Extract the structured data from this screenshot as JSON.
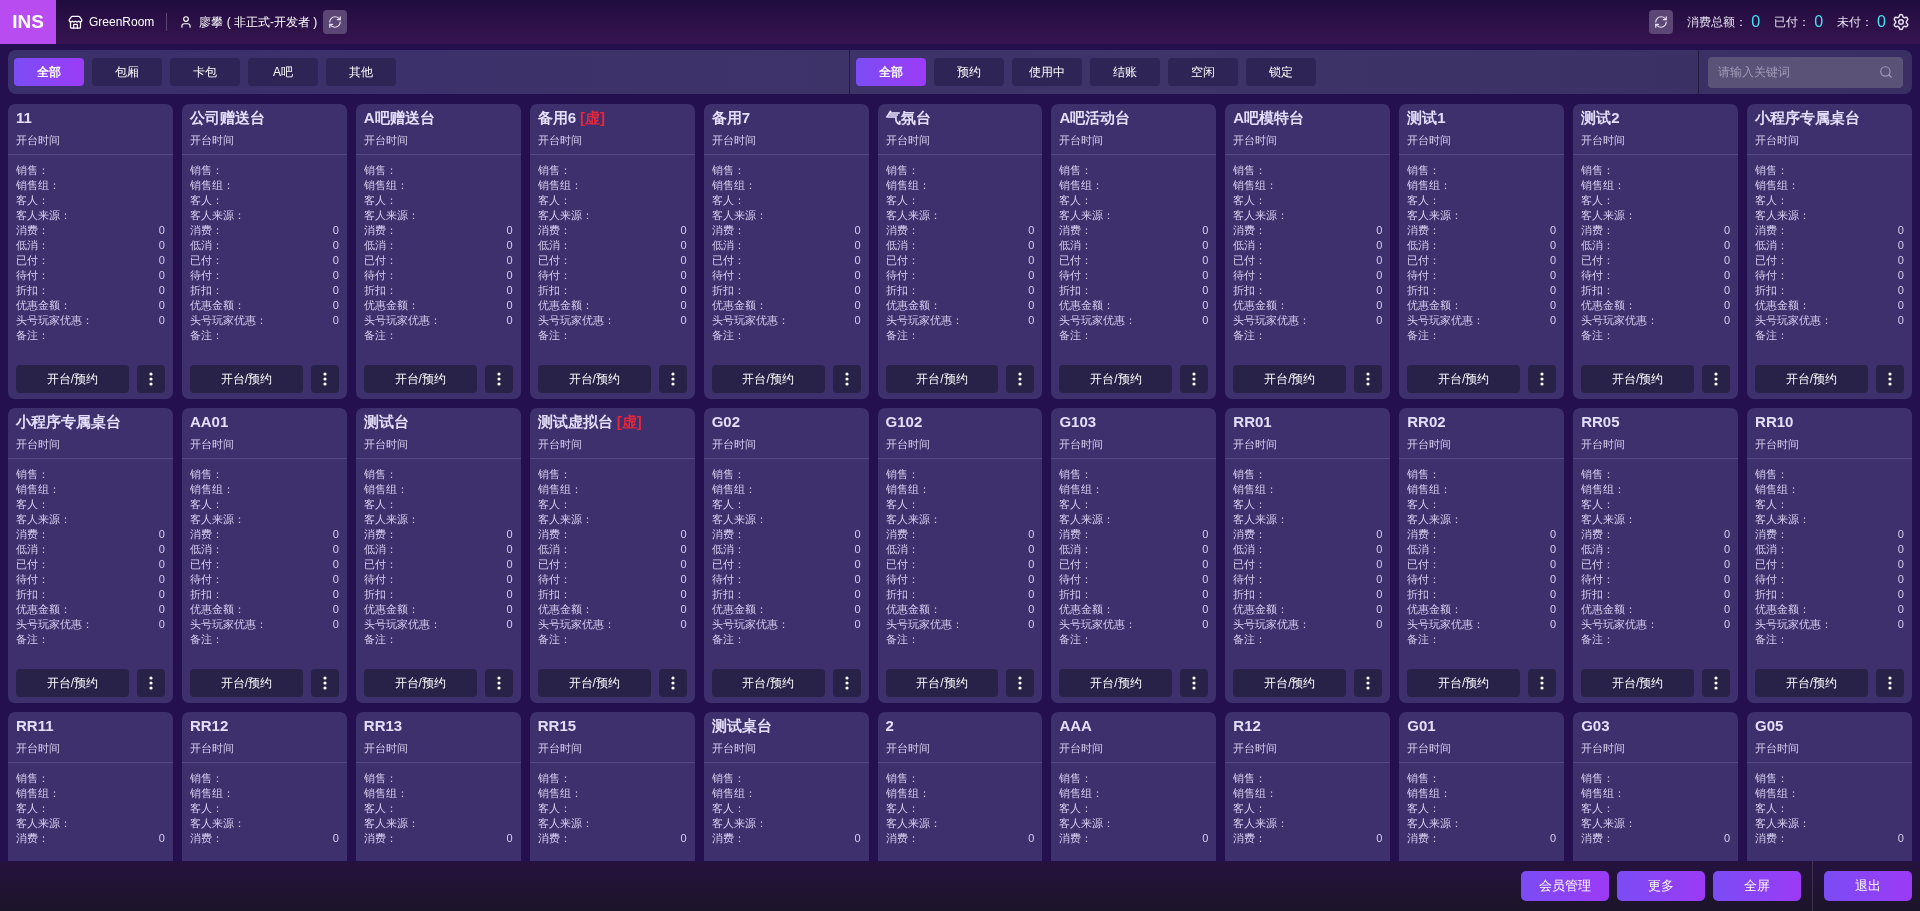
{
  "header": {
    "logo": "INS",
    "store": "GreenRoom",
    "user": "廖攀 ( 非正式-开发者 )",
    "totals": [
      {
        "label": "消费总额：",
        "value": "0"
      },
      {
        "label": "已付：",
        "value": "0"
      },
      {
        "label": "未付：",
        "value": "0"
      }
    ]
  },
  "area_tabs": [
    {
      "label": "全部",
      "selected": true
    },
    {
      "label": "包厢",
      "selected": false
    },
    {
      "label": "卡包",
      "selected": false
    },
    {
      "label": "A吧",
      "selected": false
    },
    {
      "label": "其他",
      "selected": false
    }
  ],
  "status_tabs": [
    {
      "label": "全部",
      "selected": true
    },
    {
      "label": "预约",
      "selected": false
    },
    {
      "label": "使用中",
      "selected": false
    },
    {
      "label": "结账",
      "selected": false
    },
    {
      "label": "空闲",
      "selected": false
    },
    {
      "label": "锁定",
      "selected": false
    }
  ],
  "search": {
    "placeholder": "请输入关键词"
  },
  "cards": [
    {
      "name": "11",
      "subtitle": "开台时间",
      "fields": [
        {
          "label": "销售："
        },
        {
          "label": "销售组："
        },
        {
          "label": "客人："
        },
        {
          "label": "客人来源："
        },
        {
          "label": "消费：",
          "value": "0"
        },
        {
          "label": "低消：",
          "value": "0"
        },
        {
          "label": "已付：",
          "value": "0"
        },
        {
          "label": "待付：",
          "value": "0"
        },
        {
          "label": "折扣：",
          "value": "0"
        },
        {
          "label": "优惠金额：",
          "value": "0"
        },
        {
          "label": "头号玩家优惠：",
          "value": "0"
        },
        {
          "label": "备注："
        }
      ],
      "action": "开台/预约"
    },
    {
      "name": "公司赠送台",
      "subtitle": "开台时间",
      "fields": [
        {
          "label": "销售："
        },
        {
          "label": "销售组："
        },
        {
          "label": "客人："
        },
        {
          "label": "客人来源："
        },
        {
          "label": "消费：",
          "value": "0"
        },
        {
          "label": "低消：",
          "value": "0"
        },
        {
          "label": "已付：",
          "value": "0"
        },
        {
          "label": "待付：",
          "value": "0"
        },
        {
          "label": "折扣：",
          "value": "0"
        },
        {
          "label": "优惠金额：",
          "value": "0"
        },
        {
          "label": "头号玩家优惠：",
          "value": "0"
        },
        {
          "label": "备注："
        }
      ],
      "action": "开台/预约"
    },
    {
      "name": "A吧赠送台",
      "subtitle": "开台时间",
      "fields": [
        {
          "label": "销售："
        },
        {
          "label": "销售组："
        },
        {
          "label": "客人："
        },
        {
          "label": "客人来源："
        },
        {
          "label": "消费：",
          "value": "0"
        },
        {
          "label": "低消：",
          "value": "0"
        },
        {
          "label": "已付：",
          "value": "0"
        },
        {
          "label": "待付：",
          "value": "0"
        },
        {
          "label": "折扣：",
          "value": "0"
        },
        {
          "label": "优惠金额：",
          "value": "0"
        },
        {
          "label": "头号玩家优惠：",
          "value": "0"
        },
        {
          "label": "备注："
        }
      ],
      "action": "开台/预约"
    },
    {
      "name": "备用6",
      "tag": "[虚]",
      "subtitle": "开台时间",
      "fields": [
        {
          "label": "销售："
        },
        {
          "label": "销售组："
        },
        {
          "label": "客人："
        },
        {
          "label": "客人来源："
        },
        {
          "label": "消费：",
          "value": "0"
        },
        {
          "label": "低消：",
          "value": "0"
        },
        {
          "label": "已付：",
          "value": "0"
        },
        {
          "label": "待付：",
          "value": "0"
        },
        {
          "label": "折扣：",
          "value": "0"
        },
        {
          "label": "优惠金额：",
          "value": "0"
        },
        {
          "label": "头号玩家优惠：",
          "value": "0"
        },
        {
          "label": "备注："
        }
      ],
      "action": "开台/预约"
    },
    {
      "name": "备用7",
      "subtitle": "开台时间",
      "fields": [
        {
          "label": "销售："
        },
        {
          "label": "销售组："
        },
        {
          "label": "客人："
        },
        {
          "label": "客人来源："
        },
        {
          "label": "消费：",
          "value": "0"
        },
        {
          "label": "低消：",
          "value": "0"
        },
        {
          "label": "已付：",
          "value": "0"
        },
        {
          "label": "待付：",
          "value": "0"
        },
        {
          "label": "折扣：",
          "value": "0"
        },
        {
          "label": "优惠金额：",
          "value": "0"
        },
        {
          "label": "头号玩家优惠：",
          "value": "0"
        },
        {
          "label": "备注："
        }
      ],
      "action": "开台/预约"
    },
    {
      "name": "气氛台",
      "subtitle": "开台时间",
      "fields": [
        {
          "label": "销售："
        },
        {
          "label": "销售组："
        },
        {
          "label": "客人："
        },
        {
          "label": "客人来源："
        },
        {
          "label": "消费：",
          "value": "0"
        },
        {
          "label": "低消：",
          "value": "0"
        },
        {
          "label": "已付：",
          "value": "0"
        },
        {
          "label": "待付：",
          "value": "0"
        },
        {
          "label": "折扣：",
          "value": "0"
        },
        {
          "label": "优惠金额：",
          "value": "0"
        },
        {
          "label": "头号玩家优惠：",
          "value": "0"
        },
        {
          "label": "备注："
        }
      ],
      "action": "开台/预约"
    },
    {
      "name": "A吧活动台",
      "subtitle": "开台时间",
      "fields": [
        {
          "label": "销售："
        },
        {
          "label": "销售组："
        },
        {
          "label": "客人："
        },
        {
          "label": "客人来源："
        },
        {
          "label": "消费：",
          "value": "0"
        },
        {
          "label": "低消：",
          "value": "0"
        },
        {
          "label": "已付：",
          "value": "0"
        },
        {
          "label": "待付：",
          "value": "0"
        },
        {
          "label": "折扣：",
          "value": "0"
        },
        {
          "label": "优惠金额：",
          "value": "0"
        },
        {
          "label": "头号玩家优惠：",
          "value": "0"
        },
        {
          "label": "备注："
        }
      ],
      "action": "开台/预约"
    },
    {
      "name": "A吧模特台",
      "subtitle": "开台时间",
      "fields": [
        {
          "label": "销售："
        },
        {
          "label": "销售组："
        },
        {
          "label": "客人："
        },
        {
          "label": "客人来源："
        },
        {
          "label": "消费：",
          "value": "0"
        },
        {
          "label": "低消：",
          "value": "0"
        },
        {
          "label": "已付：",
          "value": "0"
        },
        {
          "label": "待付：",
          "value": "0"
        },
        {
          "label": "折扣：",
          "value": "0"
        },
        {
          "label": "优惠金额：",
          "value": "0"
        },
        {
          "label": "头号玩家优惠：",
          "value": "0"
        },
        {
          "label": "备注："
        }
      ],
      "action": "开台/预约"
    },
    {
      "name": "测试1",
      "subtitle": "开台时间",
      "fields": [
        {
          "label": "销售："
        },
        {
          "label": "销售组："
        },
        {
          "label": "客人："
        },
        {
          "label": "客人来源："
        },
        {
          "label": "消费：",
          "value": "0"
        },
        {
          "label": "低消：",
          "value": "0"
        },
        {
          "label": "已付：",
          "value": "0"
        },
        {
          "label": "待付：",
          "value": "0"
        },
        {
          "label": "折扣：",
          "value": "0"
        },
        {
          "label": "优惠金额：",
          "value": "0"
        },
        {
          "label": "头号玩家优惠：",
          "value": "0"
        },
        {
          "label": "备注："
        }
      ],
      "action": "开台/预约"
    },
    {
      "name": "测试2",
      "subtitle": "开台时间",
      "fields": [
        {
          "label": "销售："
        },
        {
          "label": "销售组："
        },
        {
          "label": "客人："
        },
        {
          "label": "客人来源："
        },
        {
          "label": "消费：",
          "value": "0"
        },
        {
          "label": "低消：",
          "value": "0"
        },
        {
          "label": "已付：",
          "value": "0"
        },
        {
          "label": "待付：",
          "value": "0"
        },
        {
          "label": "折扣：",
          "value": "0"
        },
        {
          "label": "优惠金额：",
          "value": "0"
        },
        {
          "label": "头号玩家优惠：",
          "value": "0"
        },
        {
          "label": "备注："
        }
      ],
      "action": "开台/预约"
    },
    {
      "name": "小程序专属桌台",
      "subtitle": "开台时间",
      "fields": [
        {
          "label": "销售："
        },
        {
          "label": "销售组："
        },
        {
          "label": "客人："
        },
        {
          "label": "客人来源："
        },
        {
          "label": "消费：",
          "value": "0"
        },
        {
          "label": "低消：",
          "value": "0"
        },
        {
          "label": "已付：",
          "value": "0"
        },
        {
          "label": "待付：",
          "value": "0"
        },
        {
          "label": "折扣：",
          "value": "0"
        },
        {
          "label": "优惠金额：",
          "value": "0"
        },
        {
          "label": "头号玩家优惠：",
          "value": "0"
        },
        {
          "label": "备注："
        }
      ],
      "action": "开台/预约"
    },
    {
      "name": "小程序专属桌台",
      "subtitle": "开台时间",
      "fields": [
        {
          "label": "销售："
        },
        {
          "label": "销售组："
        },
        {
          "label": "客人："
        },
        {
          "label": "客人来源："
        },
        {
          "label": "消费：",
          "value": "0"
        },
        {
          "label": "低消：",
          "value": "0"
        },
        {
          "label": "已付：",
          "value": "0"
        },
        {
          "label": "待付：",
          "value": "0"
        },
        {
          "label": "折扣：",
          "value": "0"
        },
        {
          "label": "优惠金额：",
          "value": "0"
        },
        {
          "label": "头号玩家优惠：",
          "value": "0"
        },
        {
          "label": "备注："
        }
      ],
      "action": "开台/预约"
    },
    {
      "name": "AA01",
      "subtitle": "开台时间",
      "fields": [
        {
          "label": "销售："
        },
        {
          "label": "销售组："
        },
        {
          "label": "客人："
        },
        {
          "label": "客人来源："
        },
        {
          "label": "消费：",
          "value": "0"
        },
        {
          "label": "低消：",
          "value": "0"
        },
        {
          "label": "已付：",
          "value": "0"
        },
        {
          "label": "待付：",
          "value": "0"
        },
        {
          "label": "折扣：",
          "value": "0"
        },
        {
          "label": "优惠金额：",
          "value": "0"
        },
        {
          "label": "头号玩家优惠：",
          "value": "0"
        },
        {
          "label": "备注："
        }
      ],
      "action": "开台/预约"
    },
    {
      "name": "测试台",
      "subtitle": "开台时间",
      "fields": [
        {
          "label": "销售："
        },
        {
          "label": "销售组："
        },
        {
          "label": "客人："
        },
        {
          "label": "客人来源："
        },
        {
          "label": "消费：",
          "value": "0"
        },
        {
          "label": "低消：",
          "value": "0"
        },
        {
          "label": "已付：",
          "value": "0"
        },
        {
          "label": "待付：",
          "value": "0"
        },
        {
          "label": "折扣：",
          "value": "0"
        },
        {
          "label": "优惠金额：",
          "value": "0"
        },
        {
          "label": "头号玩家优惠：",
          "value": "0"
        },
        {
          "label": "备注："
        }
      ],
      "action": "开台/预约"
    },
    {
      "name": "测试虚拟台",
      "tag": "[虚]",
      "subtitle": "开台时间",
      "fields": [
        {
          "label": "销售："
        },
        {
          "label": "销售组："
        },
        {
          "label": "客人："
        },
        {
          "label": "客人来源："
        },
        {
          "label": "消费：",
          "value": "0"
        },
        {
          "label": "低消：",
          "value": "0"
        },
        {
          "label": "已付：",
          "value": "0"
        },
        {
          "label": "待付：",
          "value": "0"
        },
        {
          "label": "折扣：",
          "value": "0"
        },
        {
          "label": "优惠金额：",
          "value": "0"
        },
        {
          "label": "头号玩家优惠：",
          "value": "0"
        },
        {
          "label": "备注："
        }
      ],
      "action": "开台/预约"
    },
    {
      "name": "G02",
      "subtitle": "开台时间",
      "fields": [
        {
          "label": "销售："
        },
        {
          "label": "销售组："
        },
        {
          "label": "客人："
        },
        {
          "label": "客人来源："
        },
        {
          "label": "消费：",
          "value": "0"
        },
        {
          "label": "低消：",
          "value": "0"
        },
        {
          "label": "已付：",
          "value": "0"
        },
        {
          "label": "待付：",
          "value": "0"
        },
        {
          "label": "折扣：",
          "value": "0"
        },
        {
          "label": "优惠金额：",
          "value": "0"
        },
        {
          "label": "头号玩家优惠：",
          "value": "0"
        },
        {
          "label": "备注："
        }
      ],
      "action": "开台/预约"
    },
    {
      "name": "G102",
      "subtitle": "开台时间",
      "fields": [
        {
          "label": "销售："
        },
        {
          "label": "销售组："
        },
        {
          "label": "客人："
        },
        {
          "label": "客人来源："
        },
        {
          "label": "消费：",
          "value": "0"
        },
        {
          "label": "低消：",
          "value": "0"
        },
        {
          "label": "已付：",
          "value": "0"
        },
        {
          "label": "待付：",
          "value": "0"
        },
        {
          "label": "折扣：",
          "value": "0"
        },
        {
          "label": "优惠金额：",
          "value": "0"
        },
        {
          "label": "头号玩家优惠：",
          "value": "0"
        },
        {
          "label": "备注："
        }
      ],
      "action": "开台/预约"
    },
    {
      "name": "G103",
      "subtitle": "开台时间",
      "fields": [
        {
          "label": "销售："
        },
        {
          "label": "销售组："
        },
        {
          "label": "客人："
        },
        {
          "label": "客人来源："
        },
        {
          "label": "消费：",
          "value": "0"
        },
        {
          "label": "低消：",
          "value": "0"
        },
        {
          "label": "已付：",
          "value": "0"
        },
        {
          "label": "待付：",
          "value": "0"
        },
        {
          "label": "折扣：",
          "value": "0"
        },
        {
          "label": "优惠金额：",
          "value": "0"
        },
        {
          "label": "头号玩家优惠：",
          "value": "0"
        },
        {
          "label": "备注："
        }
      ],
      "action": "开台/预约"
    },
    {
      "name": "RR01",
      "subtitle": "开台时间",
      "fields": [
        {
          "label": "销售："
        },
        {
          "label": "销售组："
        },
        {
          "label": "客人："
        },
        {
          "label": "客人来源："
        },
        {
          "label": "消费：",
          "value": "0"
        },
        {
          "label": "低消：",
          "value": "0"
        },
        {
          "label": "已付：",
          "value": "0"
        },
        {
          "label": "待付：",
          "value": "0"
        },
        {
          "label": "折扣：",
          "value": "0"
        },
        {
          "label": "优惠金额：",
          "value": "0"
        },
        {
          "label": "头号玩家优惠：",
          "value": "0"
        },
        {
          "label": "备注："
        }
      ],
      "action": "开台/预约"
    },
    {
      "name": "RR02",
      "subtitle": "开台时间",
      "fields": [
        {
          "label": "销售："
        },
        {
          "label": "销售组："
        },
        {
          "label": "客人："
        },
        {
          "label": "客人来源："
        },
        {
          "label": "消费：",
          "value": "0"
        },
        {
          "label": "低消：",
          "value": "0"
        },
        {
          "label": "已付：",
          "value": "0"
        },
        {
          "label": "待付：",
          "value": "0"
        },
        {
          "label": "折扣：",
          "value": "0"
        },
        {
          "label": "优惠金额：",
          "value": "0"
        },
        {
          "label": "头号玩家优惠：",
          "value": "0"
        },
        {
          "label": "备注："
        }
      ],
      "action": "开台/预约"
    },
    {
      "name": "RR05",
      "subtitle": "开台时间",
      "fields": [
        {
          "label": "销售："
        },
        {
          "label": "销售组："
        },
        {
          "label": "客人："
        },
        {
          "label": "客人来源："
        },
        {
          "label": "消费：",
          "value": "0"
        },
        {
          "label": "低消：",
          "value": "0"
        },
        {
          "label": "已付：",
          "value": "0"
        },
        {
          "label": "待付：",
          "value": "0"
        },
        {
          "label": "折扣：",
          "value": "0"
        },
        {
          "label": "优惠金额：",
          "value": "0"
        },
        {
          "label": "头号玩家优惠：",
          "value": "0"
        },
        {
          "label": "备注："
        }
      ],
      "action": "开台/预约"
    },
    {
      "name": "RR10",
      "subtitle": "开台时间",
      "fields": [
        {
          "label": "销售："
        },
        {
          "label": "销售组："
        },
        {
          "label": "客人："
        },
        {
          "label": "客人来源："
        },
        {
          "label": "消费：",
          "value": "0"
        },
        {
          "label": "低消：",
          "value": "0"
        },
        {
          "label": "已付：",
          "value": "0"
        },
        {
          "label": "待付：",
          "value": "0"
        },
        {
          "label": "折扣：",
          "value": "0"
        },
        {
          "label": "优惠金额：",
          "value": "0"
        },
        {
          "label": "头号玩家优惠：",
          "value": "0"
        },
        {
          "label": "备注："
        }
      ],
      "action": "开台/预约"
    },
    {
      "name": "RR11",
      "subtitle": "开台时间",
      "fields": [
        {
          "label": "销售："
        },
        {
          "label": "销售组："
        },
        {
          "label": "客人："
        },
        {
          "label": "客人来源："
        },
        {
          "label": "消费：",
          "value": "0"
        }
      ]
    },
    {
      "name": "RR12",
      "subtitle": "开台时间",
      "fields": [
        {
          "label": "销售："
        },
        {
          "label": "销售组："
        },
        {
          "label": "客人："
        },
        {
          "label": "客人来源："
        },
        {
          "label": "消费：",
          "value": "0"
        }
      ]
    },
    {
      "name": "RR13",
      "subtitle": "开台时间",
      "fields": [
        {
          "label": "销售："
        },
        {
          "label": "销售组："
        },
        {
          "label": "客人："
        },
        {
          "label": "客人来源："
        },
        {
          "label": "消费：",
          "value": "0"
        }
      ]
    },
    {
      "name": "RR15",
      "subtitle": "开台时间",
      "fields": [
        {
          "label": "销售："
        },
        {
          "label": "销售组："
        },
        {
          "label": "客人："
        },
        {
          "label": "客人来源："
        },
        {
          "label": "消费：",
          "value": "0"
        }
      ]
    },
    {
      "name": "测试桌台",
      "subtitle": "开台时间",
      "fields": [
        {
          "label": "销售："
        },
        {
          "label": "销售组："
        },
        {
          "label": "客人："
        },
        {
          "label": "客人来源："
        },
        {
          "label": "消费：",
          "value": "0"
        }
      ]
    },
    {
      "name": "2",
      "subtitle": "开台时间",
      "fields": [
        {
          "label": "销售："
        },
        {
          "label": "销售组："
        },
        {
          "label": "客人："
        },
        {
          "label": "客人来源："
        },
        {
          "label": "消费：",
          "value": "0"
        }
      ]
    },
    {
      "name": "AAA",
      "subtitle": "开台时间",
      "fields": [
        {
          "label": "销售："
        },
        {
          "label": "销售组："
        },
        {
          "label": "客人："
        },
        {
          "label": "客人来源："
        },
        {
          "label": "消费：",
          "value": "0"
        }
      ]
    },
    {
      "name": "R12",
      "subtitle": "开台时间",
      "fields": [
        {
          "label": "销售："
        },
        {
          "label": "销售组："
        },
        {
          "label": "客人："
        },
        {
          "label": "客人来源："
        },
        {
          "label": "消费：",
          "value": "0"
        }
      ]
    },
    {
      "name": "G01",
      "subtitle": "开台时间",
      "fields": [
        {
          "label": "销售："
        },
        {
          "label": "销售组："
        },
        {
          "label": "客人："
        },
        {
          "label": "客人来源："
        },
        {
          "label": "消费：",
          "value": "0"
        }
      ]
    },
    {
      "name": "G03",
      "subtitle": "开台时间",
      "fields": [
        {
          "label": "销售："
        },
        {
          "label": "销售组："
        },
        {
          "label": "客人："
        },
        {
          "label": "客人来源："
        },
        {
          "label": "消费：",
          "value": "0"
        }
      ]
    },
    {
      "name": "G05",
      "subtitle": "开台时间",
      "fields": [
        {
          "label": "销售："
        },
        {
          "label": "销售组："
        },
        {
          "label": "客人："
        },
        {
          "label": "客人来源："
        },
        {
          "label": "消费：",
          "value": "0"
        }
      ]
    }
  ],
  "footer_buttons": [
    "会员管理",
    "更多",
    "全屏"
  ],
  "exit_button": "退出"
}
